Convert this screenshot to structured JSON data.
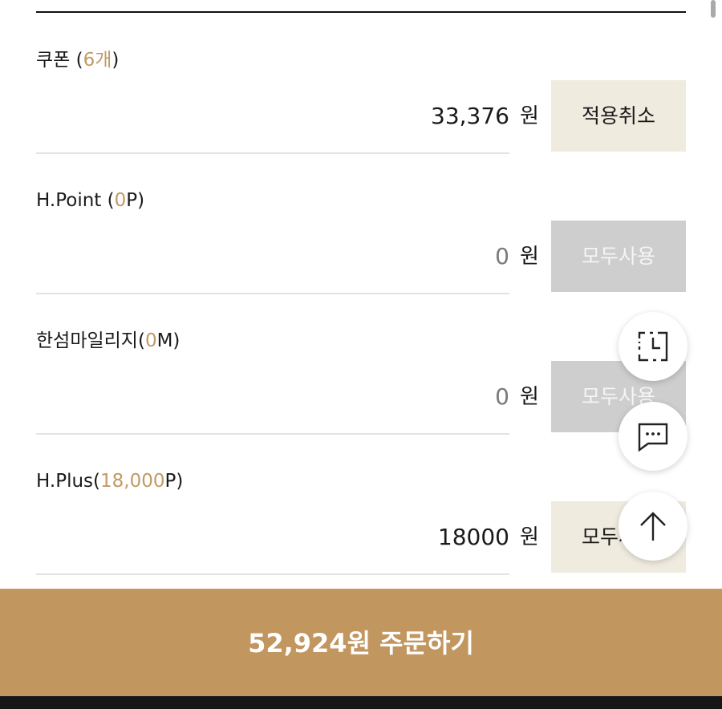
{
  "sections": {
    "coupon": {
      "label": "쿠폰 (",
      "count": "6개",
      "label_end": ")",
      "amount": "33,376",
      "unit": "원",
      "button": "적용취소"
    },
    "hpoint": {
      "label": "H.Point (",
      "count": "0",
      "label_end": "P)",
      "amount": "0",
      "unit": "원",
      "button": "모두사용"
    },
    "mileage": {
      "label": "한섬마일리지(",
      "count": "0",
      "label_end": "M)",
      "amount": "0",
      "unit": "원",
      "button": "모두사용"
    },
    "hplus": {
      "label": "H.Plus(",
      "count": "18,000",
      "label_end": "P)",
      "amount": "18000",
      "unit": "원",
      "button": "모두사용"
    }
  },
  "order_button": "52,924원 주문하기",
  "floating_buttons": {
    "recent": "recent-view-icon",
    "chat": "chat-icon",
    "top": "arrow-up-icon"
  },
  "colors": {
    "accent": "#c19a64",
    "order_bar": "#c2965f",
    "button_active": "#efebdf",
    "button_disabled": "#cecece"
  }
}
